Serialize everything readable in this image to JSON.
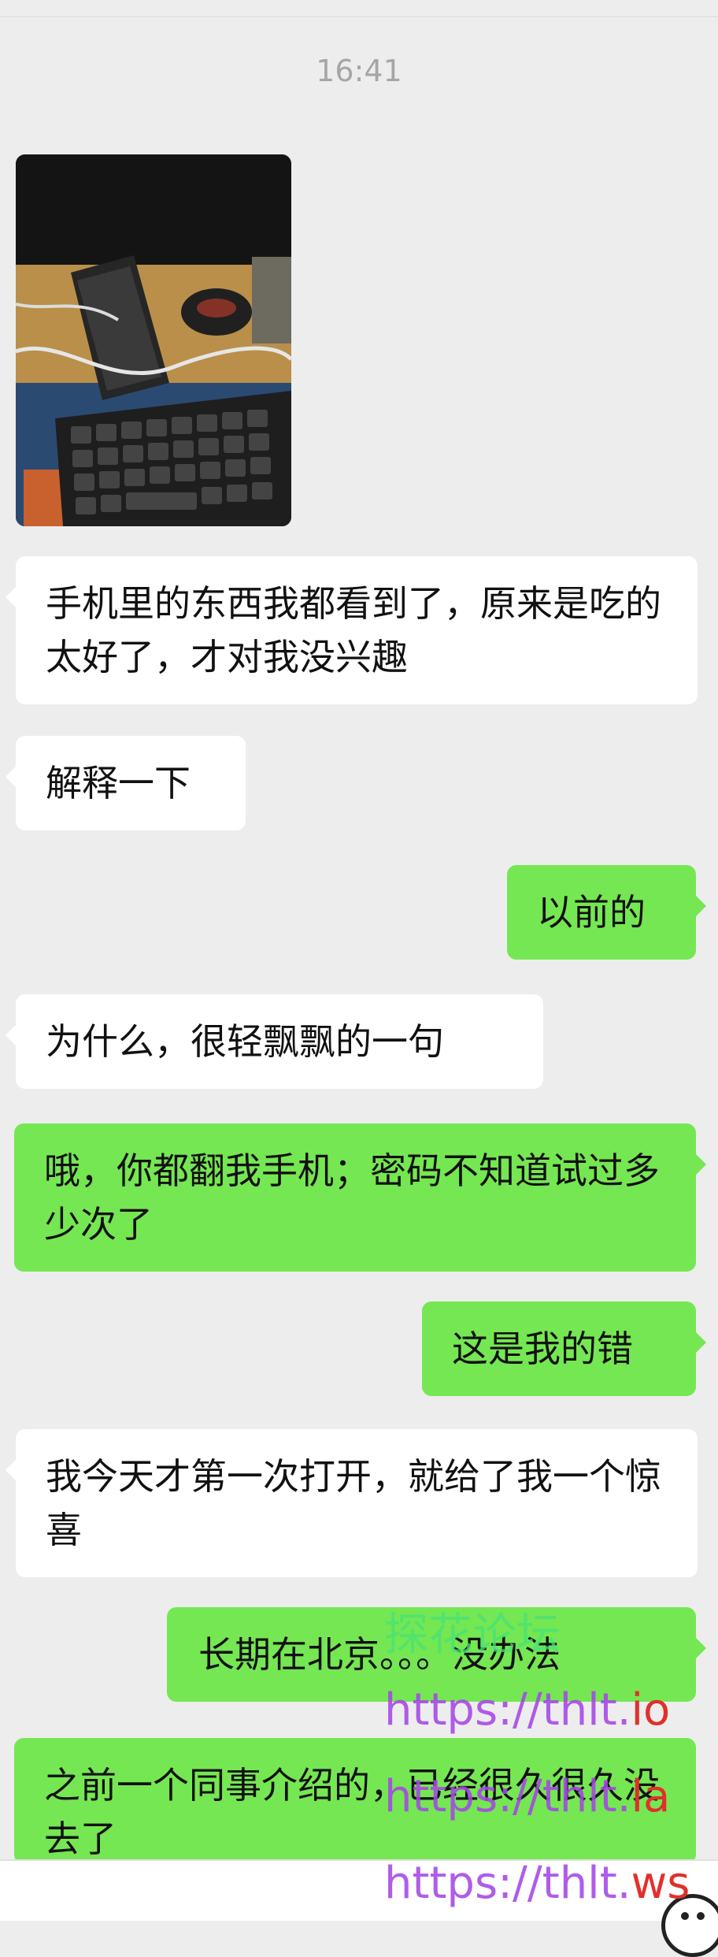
{
  "chat": {
    "timestamp": "16:41",
    "messages": [
      {
        "side": "in",
        "type": "image",
        "image_alt": "desk with phone, mouse and keyboard"
      },
      {
        "side": "in",
        "text": "手机里的东西我都看到了，原来是吃的太好了，才对我没兴趣"
      },
      {
        "side": "in",
        "text": "解释一下"
      },
      {
        "side": "out",
        "text": "以前的"
      },
      {
        "side": "in",
        "text": "为什么，很轻飘飘的一句"
      },
      {
        "side": "out",
        "text": "哦，你都翻我手机；密码不知道试过多少次了"
      },
      {
        "side": "out",
        "text": "这是我的错"
      },
      {
        "side": "in",
        "text": "我今天才第一次打开，就给了我一个惊喜"
      },
      {
        "side": "out",
        "text": "长期在北京。。。没办法"
      },
      {
        "side": "out",
        "text": "之前一个同事介绍的，已经很久很久没去了"
      }
    ]
  },
  "watermark": {
    "forum_name": "探花论坛",
    "urls": [
      {
        "base": "https://thlt.",
        "tld": "io"
      },
      {
        "base": "https://thlt.",
        "tld": "la"
      },
      {
        "base": "https://thlt.",
        "tld": "ws"
      }
    ]
  },
  "colors": {
    "background": "#ededed",
    "incoming_bubble": "#ffffff",
    "outgoing_bubble": "#75e752",
    "timestamp": "#a6a6a6"
  },
  "icons": {
    "emoji_button": "smiley-face-icon"
  }
}
